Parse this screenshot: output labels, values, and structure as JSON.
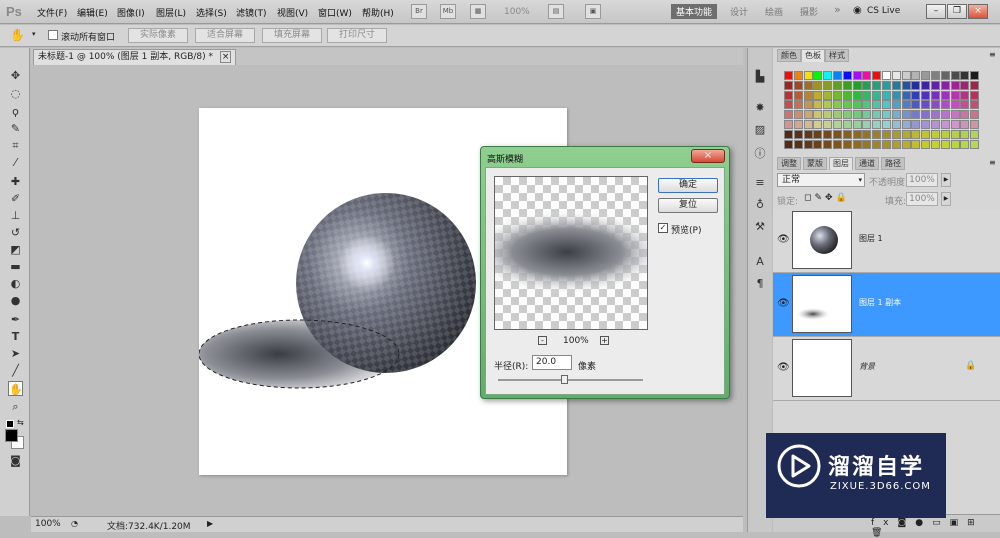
{
  "app": {
    "logo": "Ps"
  },
  "menu": [
    "文件(F)",
    "编辑(E)",
    "图像(I)",
    "图层(L)",
    "选择(S)",
    "滤镜(T)",
    "视图(V)",
    "窗口(W)",
    "帮助(H)"
  ],
  "toolbar_top": {
    "br": "Br",
    "mb": "Mb",
    "zoom": "100%"
  },
  "workspaces": {
    "active": "基本功能",
    "items": [
      "设计",
      "绘画",
      "摄影"
    ],
    "more": "»",
    "cslive": "CS Live"
  },
  "options": {
    "scroll_all": "滚动所有窗口",
    "buttons": [
      "实际像素",
      "适合屏幕",
      "填充屏幕",
      "打印尺寸"
    ]
  },
  "document": {
    "tab": "未标题-1 @ 100% (图层 1 副本, RGB/8) *",
    "close": "×"
  },
  "status": {
    "zoom": "100%",
    "doc": "文档:732.4K/1.20M"
  },
  "swatch_panel": {
    "tabs": [
      "颜色",
      "色板",
      "样式"
    ],
    "selected": "色板"
  },
  "layers_panel": {
    "tabs": [
      "调整",
      "蒙版",
      "图层",
      "通道",
      "路径"
    ],
    "selected": "图层",
    "blend_mode": "正常",
    "opacity_label": "不透明度:",
    "opacity": "100%",
    "lock_label": "锁定:",
    "fill_label": "填充:",
    "fill": "100%",
    "layers": [
      {
        "name": "图层 1",
        "selected": false
      },
      {
        "name": "图层 1 副本",
        "selected": true
      },
      {
        "name": "背景",
        "selected": false,
        "locked": true
      }
    ]
  },
  "dialog": {
    "title": "高斯模糊",
    "ok": "确定",
    "reset": "复位",
    "preview_label": "预览(P)",
    "preview_checked": true,
    "zoom": "100%",
    "minus": "-",
    "plus": "+",
    "radius_label": "半径(R):",
    "radius_value": "20.0",
    "unit": "像素"
  },
  "watermark": {
    "title": "溜溜自学",
    "url": "ZIXUE.3D66.COM"
  },
  "colors": {
    "selection": "#3d99ff",
    "dialog_frame": "#6cba77",
    "watermark_bg": "#1f2b55"
  }
}
